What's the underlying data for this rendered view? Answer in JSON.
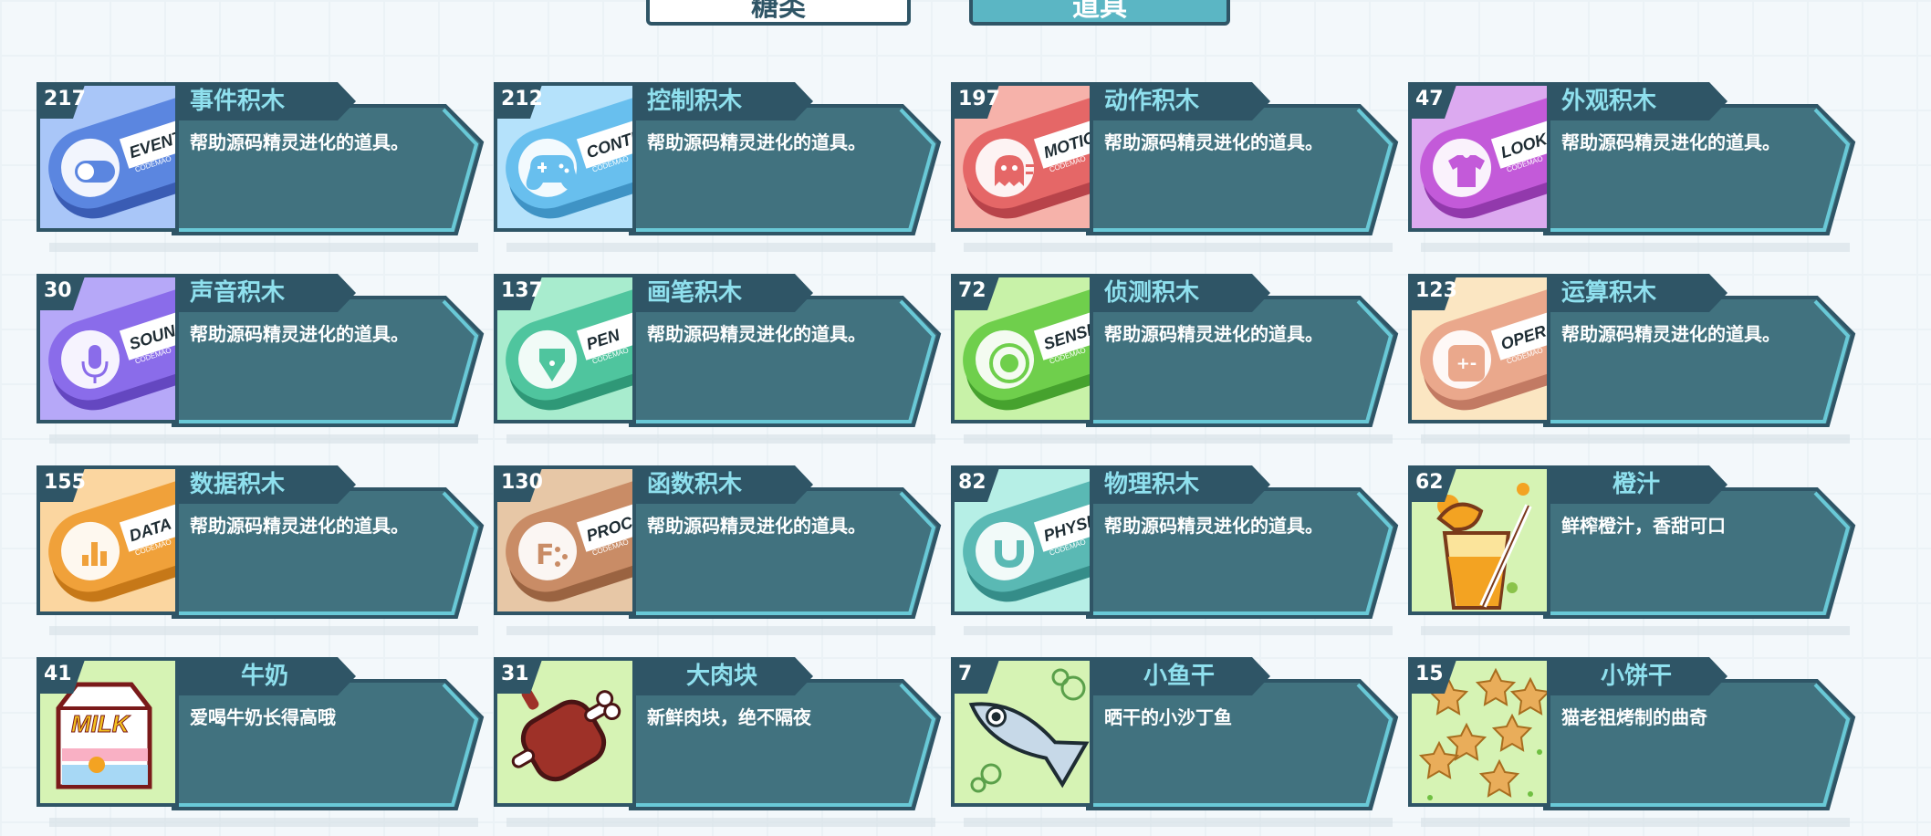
{
  "tabs": [
    {
      "label": "糖类"
    },
    {
      "label": "道具"
    }
  ],
  "items": [
    {
      "count": "217",
      "name": "事件积木",
      "desc": "帮助源码精灵进化的道具。",
      "icon": "events-block-icon",
      "kind": "block",
      "bg": "#a9c6f8",
      "blob": "#5b86e0",
      "dark": "#3a5cb4",
      "glyph": "toggle",
      "tag": "EVENTS"
    },
    {
      "count": "212",
      "name": "控制积木",
      "desc": "帮助源码精灵进化的道具。",
      "icon": "control-block-icon",
      "kind": "block",
      "bg": "#b5e2fb",
      "blob": "#68bfee",
      "dark": "#3f93c5",
      "glyph": "gamepad",
      "tag": "CONTRO"
    },
    {
      "count": "197",
      "name": "动作积木",
      "desc": "帮助源码精灵进化的道具。",
      "icon": "motion-block-icon",
      "kind": "block",
      "bg": "#f6b2aa",
      "blob": "#e56767",
      "dark": "#b8434a",
      "glyph": "ghost",
      "tag": "MOTION"
    },
    {
      "count": "47",
      "name": "外观积木",
      "desc": "帮助源码精灵进化的道具。",
      "icon": "looks-block-icon",
      "kind": "block",
      "bg": "#dcaaf0",
      "blob": "#c35ad9",
      "dark": "#9239ac",
      "glyph": "shirt",
      "tag": "LOOKS"
    },
    {
      "count": "30",
      "name": "声音积木",
      "desc": "帮助源码精灵进化的道具。",
      "icon": "sound-block-icon",
      "kind": "block",
      "bg": "#b6a8f8",
      "blob": "#8a6cea",
      "dark": "#6447c0",
      "glyph": "mic",
      "tag": "SOUND"
    },
    {
      "count": "137",
      "name": "画笔积木",
      "desc": "帮助源码精灵进化的道具。",
      "icon": "pen-block-icon",
      "kind": "block",
      "bg": "#a8ecce",
      "blob": "#4fc59e",
      "dark": "#2f9877",
      "glyph": "pen",
      "tag": "PEN"
    },
    {
      "count": "72",
      "name": "侦测积木",
      "desc": "帮助源码精灵进化的道具。",
      "icon": "sensing-block-icon",
      "kind": "block",
      "bg": "#c8f2a8",
      "blob": "#6fcf4c",
      "dark": "#46a22e",
      "glyph": "target",
      "tag": "SENSING"
    },
    {
      "count": "123",
      "name": "运算积木",
      "desc": "帮助源码精灵进化的道具。",
      "icon": "operator-block-icon",
      "kind": "block",
      "bg": "#fbe6c2",
      "blob": "#eaa88c",
      "dark": "#c27a63",
      "glyph": "calc",
      "tag": "OPERATO"
    },
    {
      "count": "155",
      "name": "数据积木",
      "desc": "帮助源码精灵进化的道具。",
      "icon": "data-block-icon",
      "kind": "block",
      "bg": "#fbd6a0",
      "blob": "#f0a13a",
      "dark": "#c67818",
      "glyph": "chart",
      "tag": "DATA"
    },
    {
      "count": "130",
      "name": "函数积木",
      "desc": "帮助源码精灵进化的道具。",
      "icon": "procedure-block-icon",
      "kind": "block",
      "bg": "#e7c7a6",
      "blob": "#c98c66",
      "dark": "#9a6341",
      "glyph": "dots",
      "tag": "PROCEDU"
    },
    {
      "count": "82",
      "name": "物理积木",
      "desc": "帮助源码精灵进化的道具。",
      "icon": "physics-block-icon",
      "kind": "block",
      "bg": "#b6efe6",
      "blob": "#5ab9b4",
      "dark": "#358d89",
      "glyph": "magnet",
      "tag": "PHYSICS"
    },
    {
      "count": "62",
      "name": "橙汁",
      "desc": "鲜榨橙汁，香甜可口",
      "icon": "orange-juice-icon",
      "kind": "food",
      "bg": "#d6f3b4",
      "glyph": "juice"
    },
    {
      "count": "41",
      "name": "牛奶",
      "desc": "爱喝牛奶长得高哦",
      "icon": "milk-carton-icon",
      "kind": "food",
      "bg": "#d6f3b4",
      "glyph": "milk",
      "tag": "MILK"
    },
    {
      "count": "31",
      "name": "大肉块",
      "desc": "新鲜肉块，绝不隔夜",
      "icon": "meat-chunk-icon",
      "kind": "food",
      "bg": "#d6f3b4",
      "glyph": "meat"
    },
    {
      "count": "7",
      "name": "小鱼干",
      "desc": "晒干的小沙丁鱼",
      "icon": "dried-fish-icon",
      "kind": "food",
      "bg": "#d6f3b4",
      "glyph": "fish"
    },
    {
      "count": "15",
      "name": "小饼干",
      "desc": "猫老祖烤制的曲奇",
      "icon": "cookies-icon",
      "kind": "food",
      "bg": "#d6f3b4",
      "glyph": "cookie"
    }
  ],
  "colors": {
    "panel": "#41727f",
    "panel_border": "#2f5566",
    "panel_edge": "#69c9d7",
    "name_tab": "#2f5566",
    "name_text": "#8fe0ee"
  }
}
